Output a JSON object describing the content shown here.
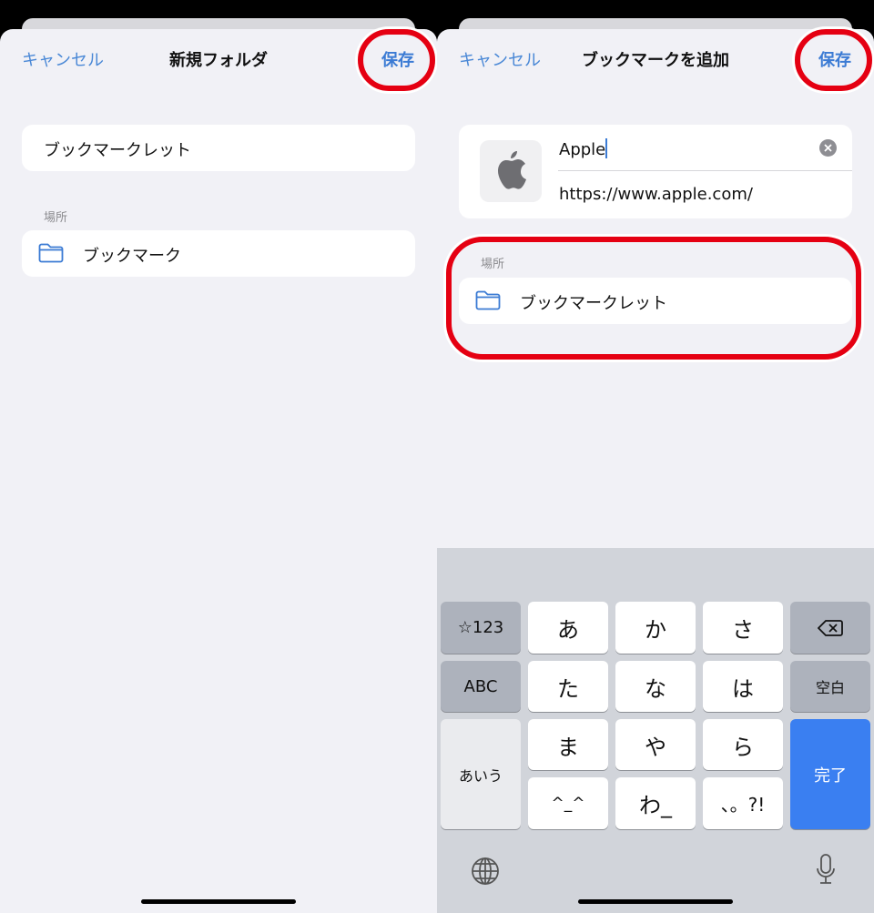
{
  "left": {
    "cancel": "キャンセル",
    "title": "新規フォルダ",
    "save": "保存",
    "folder_name": "ブックマークレット",
    "location_label": "場所",
    "location": "ブックマーク"
  },
  "right": {
    "cancel": "キャンセル",
    "title": "ブックマークを追加",
    "save": "保存",
    "bookmark_title": "Apple",
    "bookmark_url": "https://www.apple.com/",
    "location_label": "場所",
    "location": "ブックマークレット"
  },
  "keyboard": {
    "keys": {
      "sym": "☆123",
      "abc": "ABC",
      "kana": "あいう",
      "a": "あ",
      "ka": "か",
      "sa": "さ",
      "ta": "た",
      "na": "な",
      "ha": "は",
      "ma": "ま",
      "ya": "や",
      "ra": "ら",
      "emo": "^_^",
      "wa": "わ_",
      "punct": "、。?!",
      "space": "空白",
      "done": "完了"
    }
  },
  "colors": {
    "accent": "#3b7bd4",
    "highlight": "#e50012",
    "done_key": "#3a7ff1"
  }
}
